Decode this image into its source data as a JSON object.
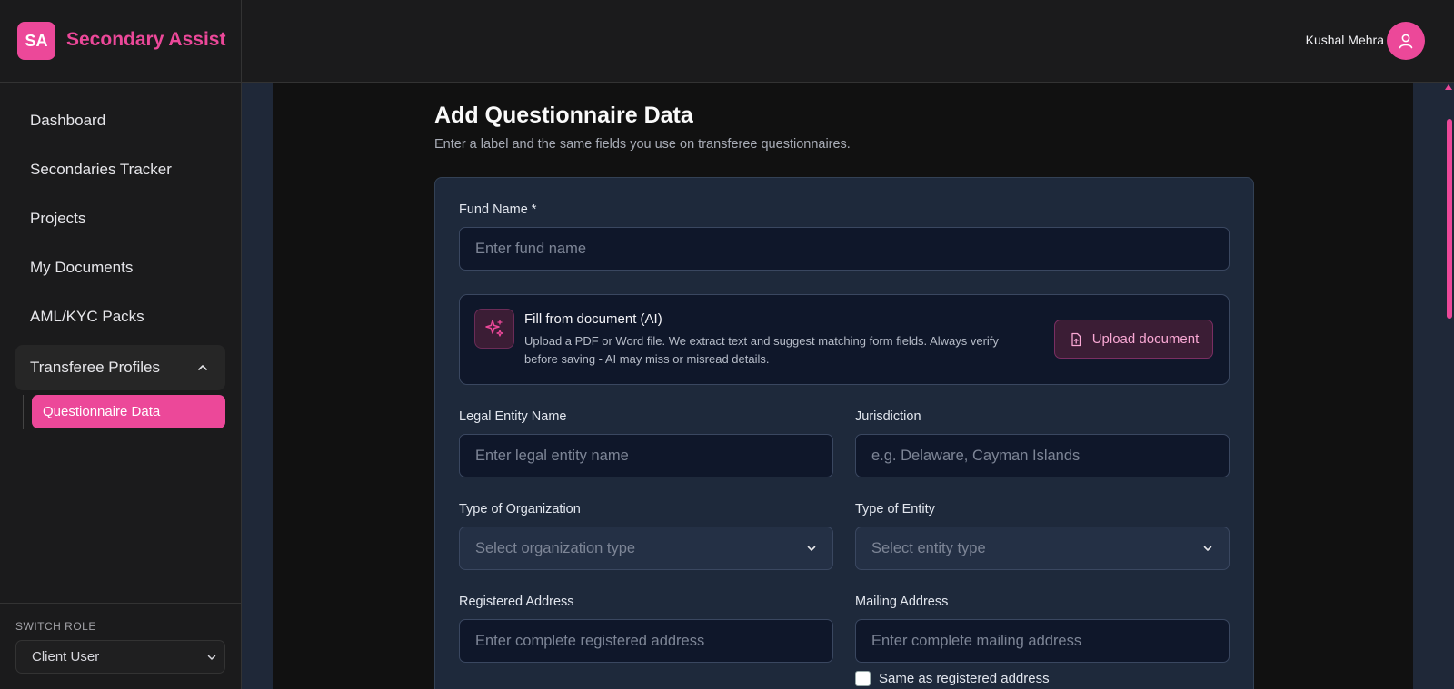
{
  "brand": {
    "logo_text": "SA",
    "name": "Secondary Assist"
  },
  "sidebar": {
    "items": [
      {
        "label": "Dashboard"
      },
      {
        "label": "Secondaries Tracker"
      },
      {
        "label": "Projects"
      },
      {
        "label": "My Documents"
      },
      {
        "label": "AML/KYC Packs"
      },
      {
        "label": "Transferee Profiles"
      }
    ],
    "sub_items": [
      {
        "label": "Questionnaire Data"
      }
    ],
    "switch_role_label": "SWITCH ROLE",
    "role_value": "Client User"
  },
  "header": {
    "user_name": "Kushal Mehra"
  },
  "page": {
    "title": "Add Questionnaire Data",
    "subtitle": "Enter a label and the same fields you use on transferee questionnaires."
  },
  "form": {
    "fund_name": {
      "label": "Fund Name *",
      "placeholder": "Enter fund name"
    },
    "ai_fill": {
      "title": "Fill from document (AI)",
      "description": "Upload a PDF or Word file. We extract text and suggest matching form fields. Always verify before saving - AI may miss or misread details.",
      "button_label": "Upload document"
    },
    "legal_entity_name": {
      "label": "Legal Entity Name",
      "placeholder": "Enter legal entity name"
    },
    "jurisdiction": {
      "label": "Jurisdiction",
      "placeholder": "e.g. Delaware, Cayman Islands"
    },
    "organization_type": {
      "label": "Type of Organization",
      "placeholder": "Select organization type"
    },
    "entity_type": {
      "label": "Type of Entity",
      "placeholder": "Select entity type"
    },
    "registered_address": {
      "label": "Registered Address",
      "placeholder": "Enter complete registered address"
    },
    "mailing_address": {
      "label": "Mailing Address",
      "placeholder": "Enter complete mailing address"
    },
    "same_as_registered": {
      "label": "Same as registered address",
      "checked": false
    }
  },
  "colors": {
    "accent": "#ec4899",
    "card_bg": "#1e293b",
    "input_bg": "#0f172a",
    "sidebar_bg": "#1b1b1c"
  }
}
